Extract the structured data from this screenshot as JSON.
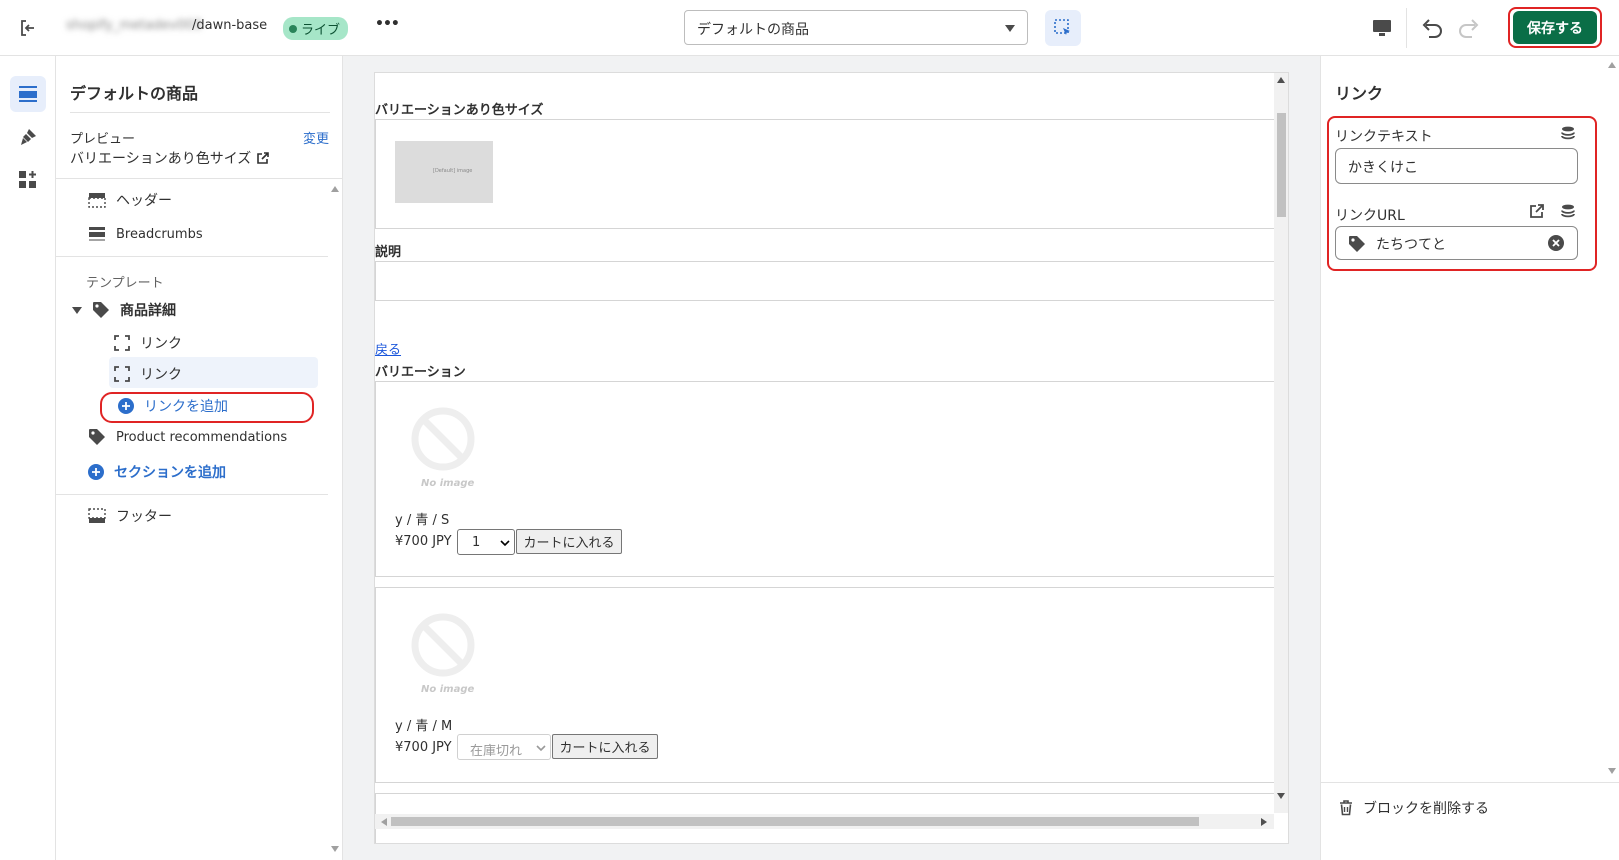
{
  "topbar": {
    "store_name": "shopify_metadev003",
    "theme_name": "/dawn-base",
    "status_badge": "ライブ",
    "more_label": "•••",
    "template_select": "デフォルトの商品",
    "save_label": "保存する"
  },
  "left": {
    "title": "デフォルトの商品",
    "preview_label": "プレビュー",
    "preview_change": "変更",
    "preview_product": "バリエーションあり色サイズ",
    "header": "ヘッダー",
    "breadcrumbs": "Breadcrumbs",
    "template_label": "テンプレート",
    "product_detail": "商品詳細",
    "link1": "リンク",
    "link2": "リンク",
    "add_link": "リンクを追加",
    "product_recommendations": "Product recommendations",
    "add_section": "セクションを追加",
    "footer": "フッター"
  },
  "preview": {
    "product_title": "バリエーションあり色サイズ",
    "thumb_text": "[Default] image",
    "description_label": "説明",
    "back_link": "戻る",
    "variations_label": "バリエーション",
    "noimage_text": "No image",
    "variants": [
      {
        "name": "y / 青 / S",
        "price": "¥700 JPY",
        "qty": "1",
        "button": "カートに入れる"
      },
      {
        "name": "y / 青 / M",
        "price": "¥700 JPY",
        "qty": "在庫切れ",
        "button": "カートに入れる"
      }
    ]
  },
  "right": {
    "title": "リンク",
    "link_text_label": "リンクテキスト",
    "link_text_value": "かきくけこ",
    "link_url_label": "リンクURL",
    "link_url_value": "たちつてと",
    "delete_block": "ブロックを削除する"
  },
  "colors": {
    "accent": "#2c6ecb",
    "save": "#0a6e47",
    "highlight": "#e02424",
    "badge": "#a6e6c8"
  }
}
